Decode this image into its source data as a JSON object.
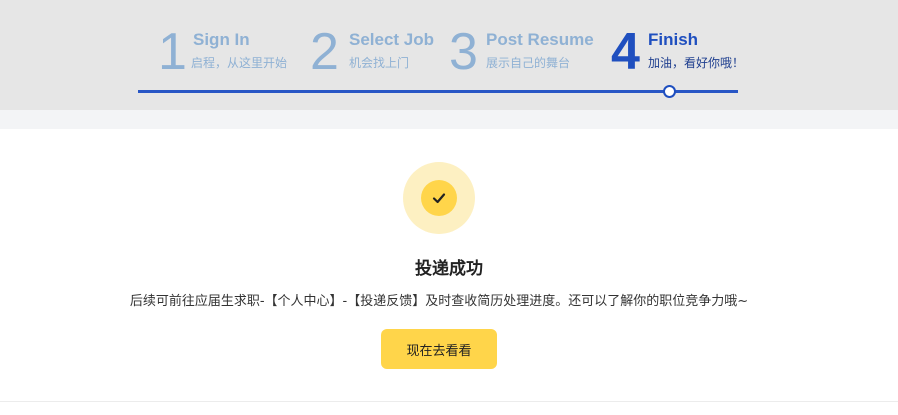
{
  "stepper": {
    "steps": [
      {
        "number": "1",
        "title": "Sign In",
        "subtitle": "启程，从这里开始",
        "active": false
      },
      {
        "number": "2",
        "title": "Select Job",
        "subtitle": "机会找上门",
        "active": false
      },
      {
        "number": "3",
        "title": "Post Resume",
        "subtitle": "展示自己的舞台",
        "active": false
      },
      {
        "number": "4",
        "title": "Finish",
        "subtitle": "加油，看好你哦！",
        "active": true
      }
    ],
    "colors": {
      "inactive": "#8fb1d4",
      "active": "#1f4fbf",
      "line": "#2856c5"
    }
  },
  "success": {
    "icon": "check-icon",
    "title": "投递成功",
    "message": "后续可前往应届生求职-【个人中心】-【投递反馈】及时查收简历处理进度。还可以了解你的职位竞争力哦~",
    "button_label": "现在去看看",
    "accent_color": "#ffd54a"
  }
}
